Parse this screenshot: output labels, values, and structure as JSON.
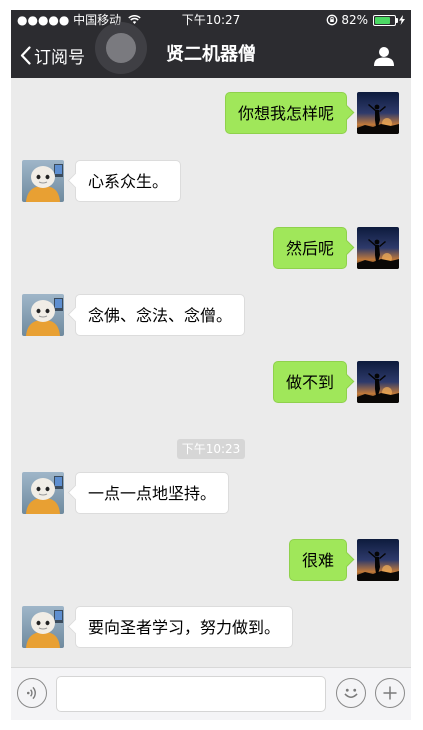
{
  "status_bar": {
    "carrier": "●●●●● 中国移动",
    "time": "下午10:27",
    "battery": "82%",
    "battery_level": 0.82
  },
  "nav": {
    "back_label": "订阅号",
    "title": "贤二机器僧"
  },
  "messages": [
    {
      "side": "right",
      "text": "你想我怎样呢",
      "avatar": "silhouette-sunset"
    },
    {
      "side": "left",
      "text": "心系众生。",
      "avatar": "robot-monk"
    },
    {
      "side": "right",
      "text": "然后呢",
      "avatar": "silhouette-sunset"
    },
    {
      "side": "left",
      "text": "念佛、念法、念僧。",
      "avatar": "robot-monk"
    },
    {
      "side": "right",
      "text": "做不到",
      "avatar": "silhouette-sunset"
    },
    {
      "side": "left",
      "text": "一点一点地坚持。",
      "avatar": "robot-monk"
    },
    {
      "side": "right",
      "text": "很难",
      "avatar": "silhouette-sunset"
    },
    {
      "side": "left",
      "text": "要向圣者学习，努力做到。",
      "avatar": "robot-monk"
    }
  ],
  "timestamp": "下午10:23",
  "input_bar": {
    "value": "",
    "voice_icon": "voice-icon",
    "emoji_icon": "emoji-icon",
    "plus_icon": "plus-icon"
  },
  "colors": {
    "nav_bg": "#2c2c30",
    "chat_bg": "#ebebeb",
    "sent_bubble": "#a0e75a",
    "received_bubble": "#ffffff",
    "battery_green": "#4cd964"
  }
}
